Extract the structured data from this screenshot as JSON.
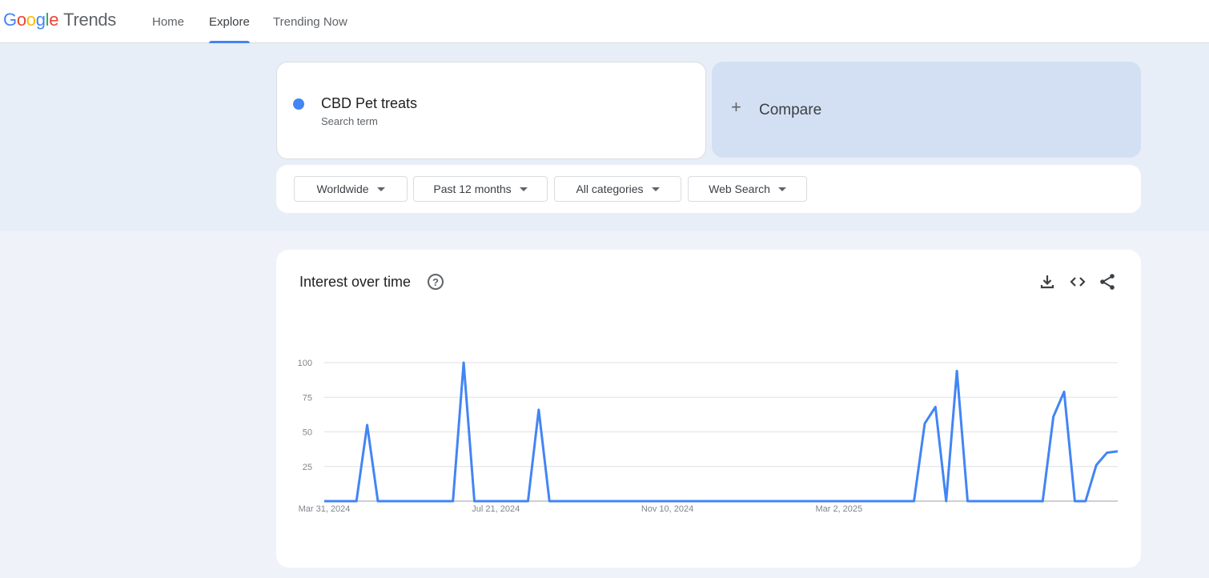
{
  "header": {
    "logo_google": [
      "G",
      "o",
      "o",
      "g",
      "l",
      "e"
    ],
    "logo_trends": "Trends",
    "nav": [
      "Home",
      "Explore",
      "Trending Now"
    ],
    "active_nav": "Explore"
  },
  "search_term": {
    "name": "CBD Pet treats",
    "type": "Search term",
    "color": "#4285f4"
  },
  "compare": {
    "label": "Compare",
    "icon": "plus-icon"
  },
  "filters": [
    "Worldwide",
    "Past 12 months",
    "All categories",
    "Web Search"
  ],
  "chart": {
    "title": "Interest over time",
    "icons": [
      "help-icon",
      "download-icon",
      "embed-code-icon",
      "share-icon"
    ]
  },
  "chart_data": {
    "type": "line",
    "title": "Interest over time",
    "x_tick_labels": [
      "Mar 31, 2024",
      "Jul 21, 2024",
      "Nov 10, 2024",
      "Mar 2, 2025"
    ],
    "y_ticks": [
      25,
      50,
      75,
      100
    ],
    "ylim": [
      0,
      100
    ],
    "grid": true,
    "color": "#4285f4",
    "series": [
      {
        "values": [
          0,
          0,
          0,
          0,
          55,
          0,
          0,
          0,
          0,
          0,
          0,
          0,
          0,
          100,
          0,
          0,
          0,
          0,
          0,
          0,
          66,
          0,
          0,
          0,
          0,
          0,
          0,
          0,
          0,
          0,
          0,
          0,
          0,
          0,
          0,
          0,
          0,
          0,
          0,
          0,
          0,
          0,
          0,
          0,
          0,
          0,
          0,
          0,
          0,
          0,
          0,
          0,
          0,
          0,
          0,
          0,
          56,
          68,
          0,
          94,
          0,
          0,
          0,
          0,
          0,
          0,
          0,
          0,
          61,
          79,
          0,
          0,
          26,
          35,
          36
        ]
      }
    ]
  }
}
